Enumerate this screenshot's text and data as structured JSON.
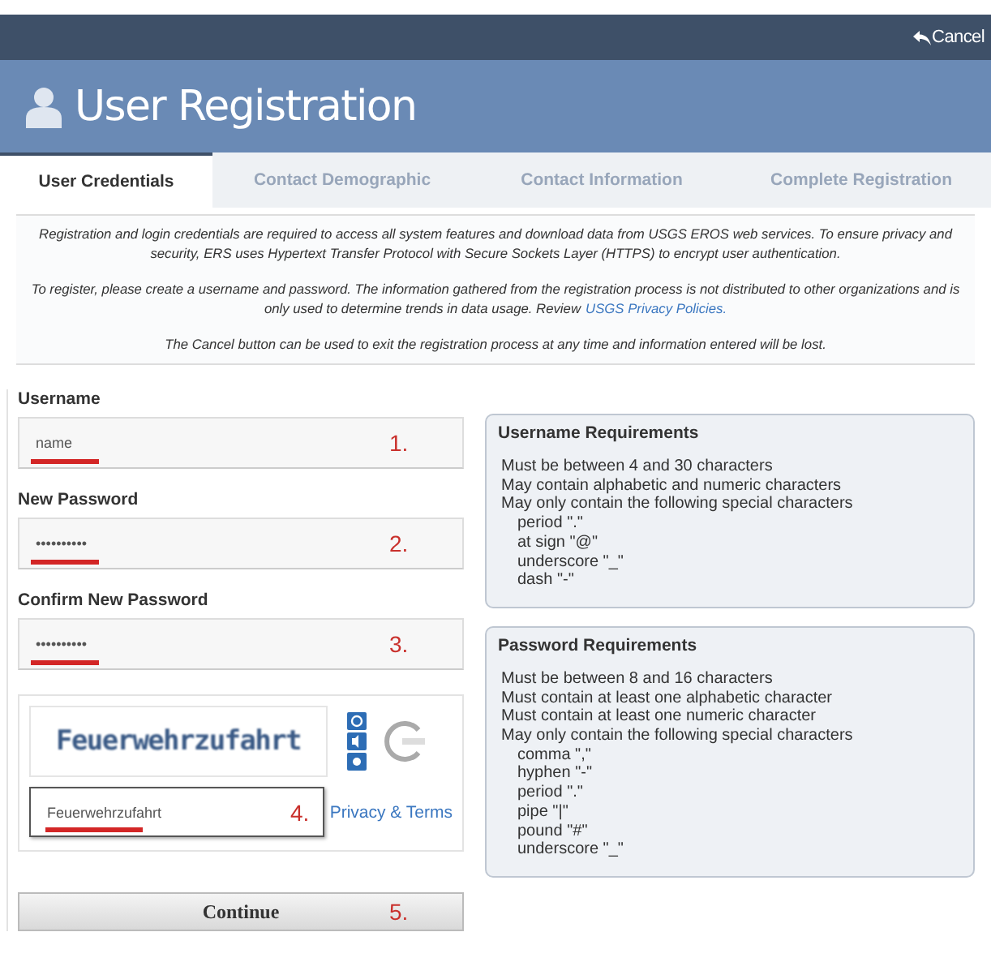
{
  "top_bar": {
    "cancel": "Cancel"
  },
  "header": {
    "title": "User Registration"
  },
  "tabs": [
    {
      "label": "User Credentials",
      "selected": true
    },
    {
      "label": "Contact Demographic",
      "selected": false
    },
    {
      "label": "Contact Information",
      "selected": false
    },
    {
      "label": "Complete Registration",
      "selected": false
    }
  ],
  "intro": {
    "paragraphs": [
      "*Registration and login credentials are required to access all system features and download data from USGS EROS web services. To ensure privacy and security, ERS uses Hypertext Transfer Protocol with Secure Sockets Layer (HTTPS) to encrypt user authentication.*",
      "*To register, please create a username and password. The information gathered from the registration process is not distributed to other organizations and is only used to determine trends in data usage. Review*",
      "*The Cancel button can be used to exit the registration process at any time and information entered will be lost.*"
    ],
    "link": "USGS Privacy Policies."
  },
  "fields": [
    {
      "label": "Username",
      "value": "name",
      "marker": "1."
    },
    {
      "label": "New Password",
      "value": "••••••••••",
      "marker": "2."
    },
    {
      "label": "Confirm New Password",
      "value": "••••••••••",
      "marker": "3."
    }
  ],
  "captcha": {
    "image_text": "Feuerwehrzufahrt",
    "value": "Feuerwehrzufahrt",
    "marker": "4.",
    "link": "Privacy & Terms"
  },
  "continue": {
    "label": "Continue",
    "marker": "5."
  },
  "requirements": [
    {
      "title": "Username Requirements",
      "items": [
        {
          "text": "Must be between 4 and 30 characters"
        },
        {
          "text": "May contain alphabetic and numeric characters"
        },
        {
          "text": "May only contain the following special characters",
          "children": [
            {
              "text": "period \".\""
            },
            {
              "text": "at sign \"@\""
            },
            {
              "text": "underscore \"_\""
            },
            {
              "text": "dash \"-\""
            }
          ]
        }
      ]
    },
    {
      "title": "Password Requirements",
      "items": [
        {
          "text": "Must be between 8 and 16 characters"
        },
        {
          "text": "Must contain at least one alphabetic character"
        },
        {
          "text": "Must contain at least one numeric character"
        },
        {
          "text": "May only contain the following special characters",
          "children": [
            {
              "text": "comma \",\""
            },
            {
              "text": "hyphen \"-\""
            },
            {
              "text": "period \".\""
            },
            {
              "text": "pipe \"|\""
            },
            {
              "text": "pound \"#\""
            },
            {
              "text": "underscore \"_\""
            }
          ]
        }
      ]
    }
  ]
}
